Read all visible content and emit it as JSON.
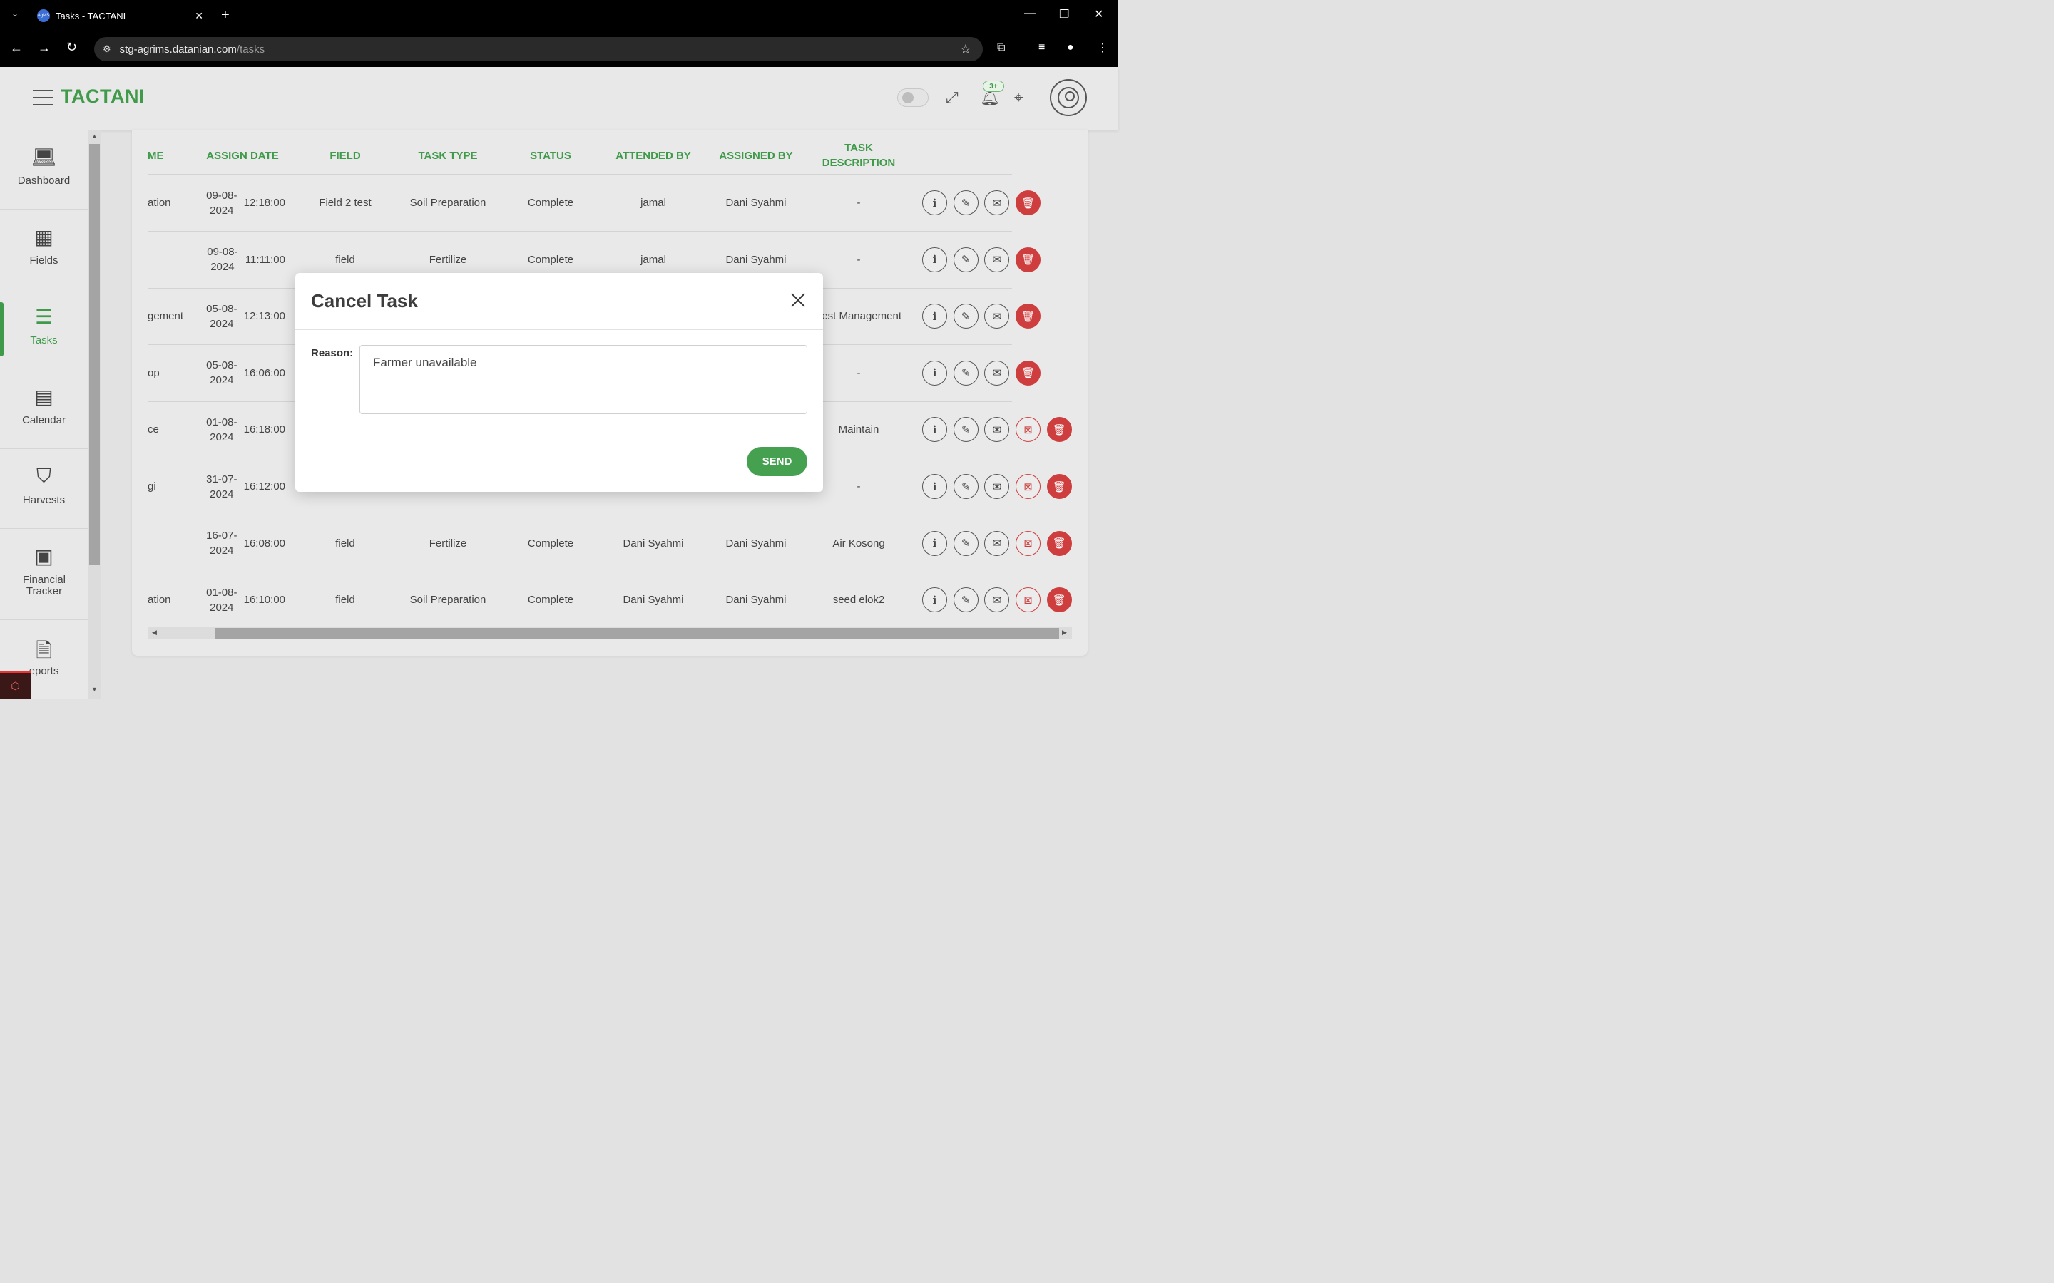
{
  "browser": {
    "tab_title": "Tasks - TACTANI",
    "favicon_text": "AgMS",
    "url_host": "stg-agrims.datanian.com",
    "url_path": "/tasks"
  },
  "header": {
    "brand": "TACTANI",
    "notification_badge": "3+"
  },
  "sidebar": {
    "items": [
      {
        "label": "Dashboard",
        "icon": "laptop-icon"
      },
      {
        "label": "Fields",
        "icon": "field-icon"
      },
      {
        "label": "Tasks",
        "icon": "tasks-icon",
        "active": true
      },
      {
        "label": "Calendar",
        "icon": "calendar-icon"
      },
      {
        "label": "Harvests",
        "icon": "basket-icon"
      },
      {
        "label": "Financial Tracker",
        "icon": "money-icon"
      },
      {
        "label": "eports",
        "icon": "report-icon"
      }
    ]
  },
  "table": {
    "headers": [
      "ME",
      "ASSIGN DATE",
      "FIELD",
      "TASK TYPE",
      "STATUS",
      "ATTENDED BY",
      "ASSIGNED BY",
      "TASK DESCRIPTION"
    ],
    "rows": [
      {
        "name": "ation",
        "date": "09-08-2024",
        "time": "12:18:00",
        "field": "Field 2 test",
        "type": "Soil Preparation",
        "status": "Complete",
        "attended": "jamal",
        "assigned": "Dani Syahmi",
        "desc": "-",
        "cancel": false
      },
      {
        "name": "",
        "date": "09-08-2024",
        "time": "11:11:00",
        "field": "field",
        "type": "Fertilize",
        "status": "Complete",
        "attended": "jamal",
        "assigned": "Dani Syahmi",
        "desc": "-",
        "cancel": false
      },
      {
        "name": "gement",
        "date": "05-08-2024",
        "time": "12:13:00",
        "field": "",
        "type": "",
        "status": "",
        "attended": "",
        "assigned": "",
        "desc": "est Management",
        "cancel": false
      },
      {
        "name": "op",
        "date": "05-08-2024",
        "time": "16:06:00",
        "field": "",
        "type": "",
        "status": "",
        "attended": "",
        "assigned": "",
        "desc": "-",
        "cancel": false
      },
      {
        "name": "ce",
        "date": "01-08-2024",
        "time": "16:18:00",
        "field": "",
        "type": "",
        "status": "",
        "attended": "",
        "assigned": "",
        "desc": "Maintain",
        "cancel": true
      },
      {
        "name": "gi",
        "date": "31-07-2024",
        "time": "16:12:00",
        "field": "",
        "type": "",
        "status": "",
        "attended": "",
        "assigned": "",
        "desc": "-",
        "cancel": true
      },
      {
        "name": "",
        "date": "16-07-2024",
        "time": "16:08:00",
        "field": "field",
        "type": "Fertilize",
        "status": "Complete",
        "attended": "Dani Syahmi",
        "assigned": "Dani Syahmi",
        "desc": "Air Kosong",
        "cancel": true
      },
      {
        "name": "ation",
        "date": "01-08-2024",
        "time": "16:10:00",
        "field": "field",
        "type": "Soil Preparation",
        "status": "Complete",
        "attended": "Dani Syahmi",
        "assigned": "Dani Syahmi",
        "desc": "seed elok2",
        "cancel": true
      }
    ]
  },
  "modal": {
    "title": "Cancel Task",
    "reason_label": "Reason:",
    "reason_value": "Farmer unavailable",
    "send_label": "SEND"
  },
  "colors": {
    "accent": "#3f9a4a",
    "danger": "#cf3e3e"
  }
}
